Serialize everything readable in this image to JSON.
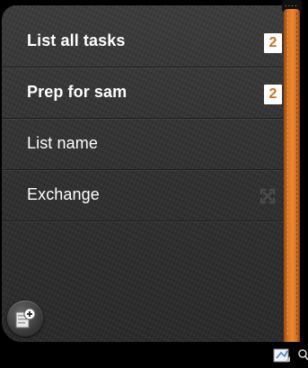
{
  "lists": [
    {
      "label": "List all tasks",
      "count": "2",
      "bold": true
    },
    {
      "label": "Prep for sam",
      "count": "2",
      "bold": true
    },
    {
      "label": "List name",
      "count": null,
      "bold": false
    },
    {
      "label": "Exchange",
      "count": null,
      "bold": false,
      "icon": "sync-icon"
    }
  ],
  "colors": {
    "accent": "#d46e1c",
    "ribbon": "#e07a27",
    "panel": "#333333"
  },
  "icons": {
    "add_list": "add-list-icon",
    "status_note": "note-icon",
    "status_search": "search-icon"
  }
}
